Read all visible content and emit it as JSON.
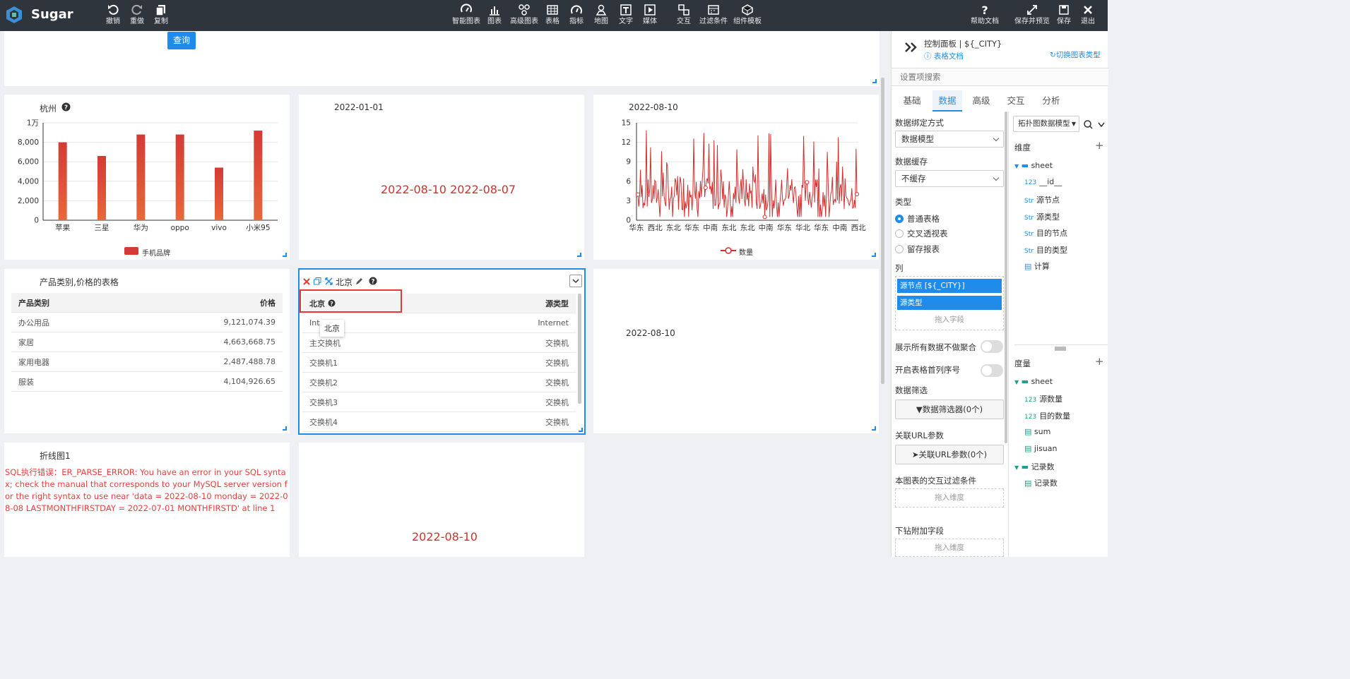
{
  "app": {
    "name": "Sugar"
  },
  "toolbar": {
    "undo": "撤销",
    "redo": "重做",
    "copy": "复制",
    "items": [
      "智能图表",
      "图表",
      "高级图表",
      "表格",
      "指标",
      "地图",
      "文字",
      "媒体",
      "交互",
      "过滤条件",
      "组件模板"
    ],
    "right": [
      "帮助文档",
      "保存并预览",
      "保存",
      "退出"
    ]
  },
  "top_card": {
    "query_button": "查询"
  },
  "bar_card": {
    "title": "杭州",
    "chart_data": {
      "type": "bar",
      "categories": [
        "苹果",
        "三星",
        "华为",
        "oppo",
        "vivo",
        "小米95"
      ],
      "values": [
        8000,
        6600,
        8800,
        8800,
        5400,
        9200
      ],
      "ylim": [
        0,
        10000
      ],
      "yticks": [
        "0",
        "2,000",
        "4,000",
        "6,000",
        "8,000",
        "1万"
      ],
      "legend": "手机品牌",
      "colors": {
        "top": "#d43a36",
        "bottom": "#e8683a"
      }
    }
  },
  "date_card1": {
    "title": "2022-01-01",
    "value": "2022-08-10 2022-08-07"
  },
  "line_card": {
    "title": "2022-08-10",
    "chart_data": {
      "type": "line",
      "ylim": [
        0,
        15
      ],
      "yticks": [
        "0",
        "3",
        "6",
        "9",
        "12",
        "15"
      ],
      "xticks": [
        "华东",
        "西北",
        "东北",
        "华东",
        "中南",
        "东北",
        "东北",
        "中南",
        "华东",
        "华北",
        "华东",
        "中南",
        "西北"
      ],
      "legend": "数量",
      "color": "#d32f2f"
    }
  },
  "table_card": {
    "title": "产品类别,价格的表格",
    "headers": [
      "产品类别",
      "价格"
    ],
    "rows": [
      [
        "办公用品",
        "9,121,074.39"
      ],
      [
        "家居",
        "4,663,668.75"
      ],
      [
        "家用电器",
        "2,487,488.78"
      ],
      [
        "服装",
        "4,104,926.65"
      ]
    ]
  },
  "sel_card": {
    "title": "北京",
    "headers": [
      "北京",
      "源类型"
    ],
    "tooltip": "北京",
    "rows": [
      [
        "Int",
        "Internet"
      ],
      [
        "主交换机",
        "交换机"
      ],
      [
        "交换机1",
        "交换机"
      ],
      [
        "交换机2",
        "交换机"
      ],
      [
        "交换机3",
        "交换机"
      ],
      [
        "交换机4",
        "交换机"
      ]
    ]
  },
  "date_card2": {
    "value": "2022-08-10"
  },
  "err_card": {
    "title": "折线图1",
    "error": "SQL执行错误：ER_PARSE_ERROR: You have an error in your SQL syntax; check the manual that corresponds to your MySQL server version for the right syntax to use near 'data = 2022-08-10 monday = 2022-08-08 LASTMONTHFIRSTDAY = 2022-07-01 MONTHFIRSTD' at line 1"
  },
  "date_card3": {
    "value": "2022-08-10"
  },
  "panel": {
    "title": "控制面板 | ${_CITY}",
    "doc_link": "表格文档",
    "switch": "切换图表类型",
    "search_placeholder": "设置项搜索",
    "tabs": [
      "基础",
      "数据",
      "高级",
      "交互",
      "分析"
    ],
    "bind_label": "数据绑定方式",
    "bind_value": "数据模型",
    "cache_label": "数据缓存",
    "cache_value": "不缓存",
    "type_label": "类型",
    "types": [
      "普通表格",
      "交叉透视表",
      "留存报表"
    ],
    "col_label": "列",
    "cols": [
      "源节点 [${_CITY}]",
      "源类型"
    ],
    "drop_field": "拖入字段",
    "show_all": "展示所有数据不做聚合",
    "seq": "开启表格首列序号",
    "filter_label": "数据筛选",
    "filter_btn": "数据筛选器(0个)",
    "url_label": "关联URL参数",
    "url_btn": "关联URL参数(0个)",
    "inter_label": "本图表的交互过滤条件",
    "drop_dim": "拖入维度",
    "drill_label": "下钻附加字段",
    "drop_dim2": "拖入维度",
    "model_select": "拓扑图数据模型",
    "dim_label": "维度",
    "dim_folder": "sheet",
    "dims": [
      {
        "t": "123",
        "n": "__id__"
      },
      {
        "t": "Str",
        "n": "源节点"
      },
      {
        "t": "Str",
        "n": "源类型"
      },
      {
        "t": "Str",
        "n": "目的节点"
      },
      {
        "t": "Str",
        "n": "目的类型"
      },
      {
        "t": "",
        "n": "计算"
      }
    ],
    "mea_label": "度量",
    "mea_folder": "sheet",
    "meas": [
      {
        "t": "123",
        "n": "源数量"
      },
      {
        "t": "123",
        "n": "目的数量"
      },
      {
        "t": "",
        "n": "sum"
      },
      {
        "t": "",
        "n": "jisuan"
      }
    ],
    "rec_folder": "记录数",
    "rec_item": "记录数"
  }
}
